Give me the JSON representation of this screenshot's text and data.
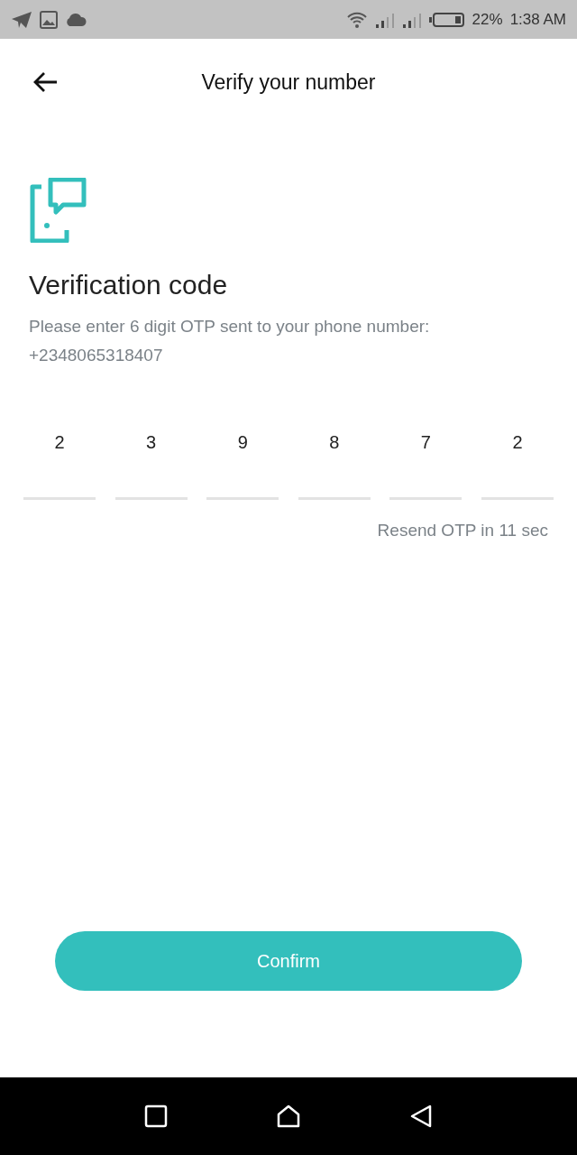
{
  "status_bar": {
    "battery": "22%",
    "time": "1:38 AM"
  },
  "header": {
    "title": "Verify your number"
  },
  "heading": "Verification code",
  "description": "Please enter 6 digit OTP sent to your phone number:",
  "phone": "+2348065318407",
  "otp": [
    "2",
    "3",
    "9",
    "8",
    "7",
    "2"
  ],
  "resend": "Resend OTP in 11 sec",
  "confirm": "Confirm"
}
